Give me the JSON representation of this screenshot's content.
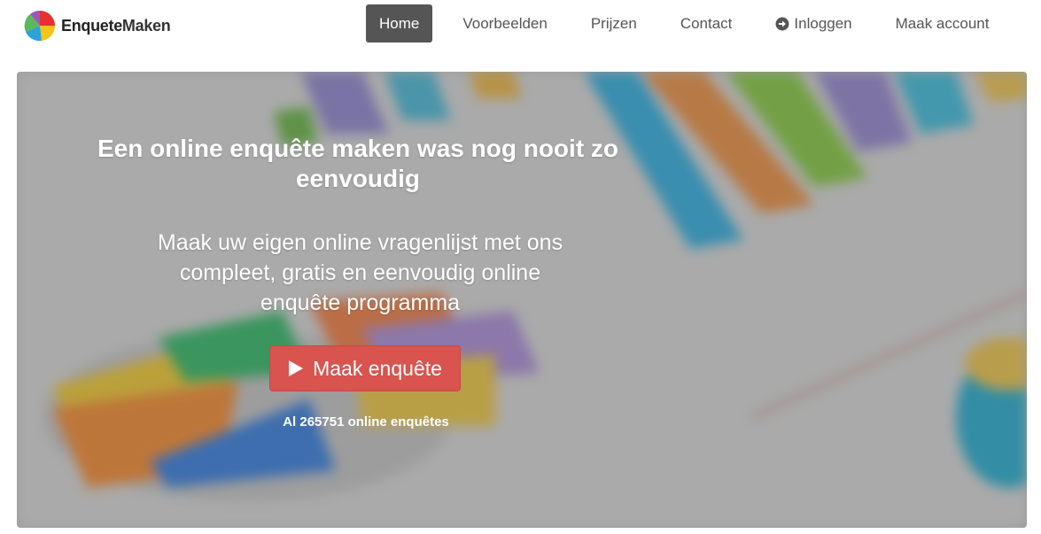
{
  "brand": {
    "name_part1": "Enquete",
    "name_part2": "Maken"
  },
  "nav": {
    "items": [
      {
        "label": "Home",
        "active": true
      },
      {
        "label": "Voorbeelden"
      },
      {
        "label": "Prijzen"
      },
      {
        "label": "Contact"
      },
      {
        "label": "Inloggen",
        "icon": "arrow-circle-right-icon"
      },
      {
        "label": "Maak account"
      }
    ]
  },
  "hero": {
    "headline": "Een online enquête maken was nog nooit zo eenvoudig",
    "subline": "Maak uw eigen online vragenlijst met ons compleet, gratis en eenvoudig online enquête programma",
    "cta_label": "Maak enquête",
    "cta_icon": "play-icon",
    "counter_text": "Al 265751 online enquêtes"
  },
  "colors": {
    "accent": "#d9534f",
    "nav_active": "#555555"
  }
}
